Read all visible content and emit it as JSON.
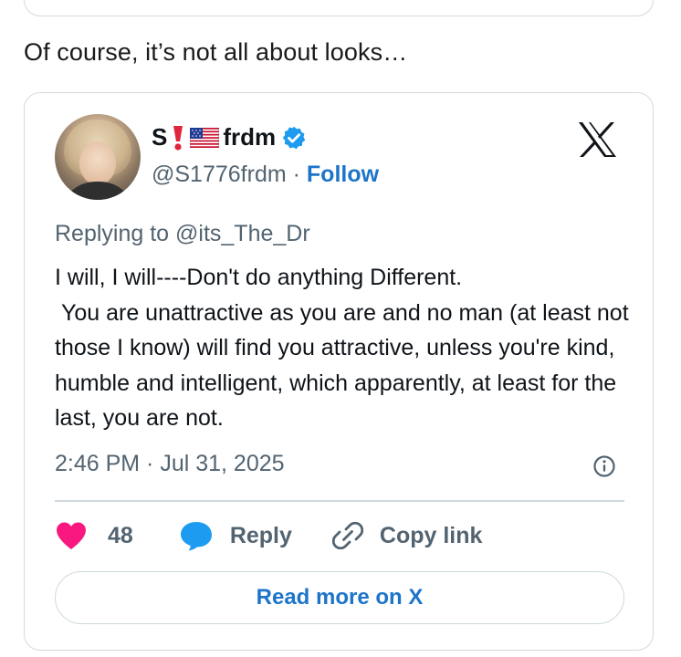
{
  "intro_text": "Of course, it’s not all about looks…",
  "tweet": {
    "name_start": "S",
    "name_end": "frdm",
    "name_emojis": [
      "heavy-exclamation-mark",
      "us-flag"
    ],
    "verified": true,
    "handle": "@S1776frdm",
    "separator": "·",
    "follow_label": "Follow",
    "platform_icon": "x-logo",
    "replying_to": "Replying to @its_The_Dr",
    "body": "I will, I will----Don't do anything Different.\n You are unattractive as you are and no man (at least not those I know) will find you attractive, unless you're kind, humble and intelligent, which apparently, at least for the last, you are not.",
    "timestamp": "2:46 PM · Jul 31, 2025",
    "like_count": "48",
    "reply_label": "Reply",
    "copy_link_label": "Copy link",
    "read_more_label": "Read more on X"
  },
  "colors": {
    "accent_blue": "#1d74c9",
    "like_pink": "#f91880",
    "muted_text": "#536471",
    "border": "#d6d9dc"
  }
}
